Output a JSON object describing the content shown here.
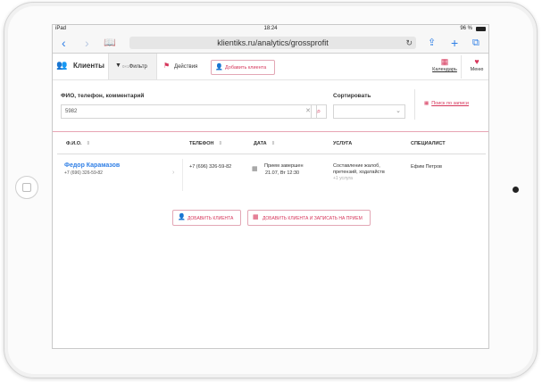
{
  "status_bar": {
    "carrier": "iPad",
    "time": "18:24",
    "battery": "96 %"
  },
  "browser": {
    "url": "klientiks.ru/analytics/grossprofit",
    "icons": [
      "back-icon",
      "forward-icon",
      "bookmarks-icon",
      "reload-icon",
      "share-icon",
      "new-tab-icon",
      "tabs-icon"
    ]
  },
  "appbar": {
    "tab_clients": "Клиенты",
    "tab_filter_badge": "0×1",
    "tab_filter": "Фильтр",
    "tab_actions": "Действия",
    "add_client": "Добавить клиента",
    "calendar": "Календарь",
    "menu": "Меню"
  },
  "search": {
    "label": "ФИО, телефон, комментарий",
    "value": "5982",
    "sort_label": "Сортировать",
    "sort_value": "",
    "search_records": "Поиск по записи"
  },
  "table": {
    "headers": {
      "name": "Ф.И.О.",
      "phone": "ТЕЛЕФОН",
      "date": "ДАТА",
      "service": "УСЛУГА",
      "specialist": "СПЕЦИАЛИСТ"
    },
    "rows": [
      {
        "name": "Федор Карамазов",
        "name_phone": "+7 (696) 326-59-82",
        "phone": "+7 (696) 326-59-82",
        "date_status": "Прием завершен",
        "date_time": "21.07, Вт 12:30",
        "service_1": "Составление жалоб,",
        "service_2": "претензий, ходатайств",
        "service_more": "+1 услуга",
        "specialist": "Ефим Петров"
      }
    ]
  },
  "actions": {
    "add_client": "ДОБАВИТЬ КЛИЕНТА",
    "add_and_book": "ДОБАВИТЬ КЛИЕНТА И ЗАПИСАТЬ НА ПРИЕМ"
  },
  "colors": {
    "accent": "#d6365b",
    "link": "#2f7fe6",
    "ios_blue": "#2f7fe6"
  }
}
